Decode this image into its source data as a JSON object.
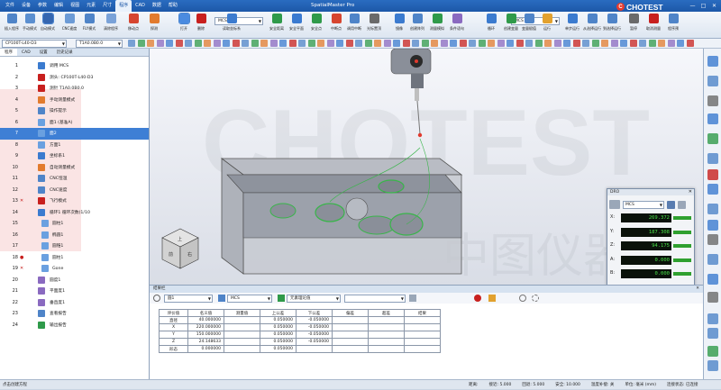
{
  "title_bar": {
    "menus": [
      "文件",
      "设备",
      "参数",
      "编辑",
      "视图",
      "元素",
      "尺寸",
      "程序",
      "CAD",
      "数据",
      "帮助"
    ],
    "active_menu": "程序",
    "app_title": "SpatialMaster Pro",
    "logo_text": "CHOTEST",
    "logo_mark": "C",
    "window_controls": [
      "—",
      "□",
      "✕"
    ]
  },
  "ribbon": {
    "buttons": [
      {
        "label": "插入程序",
        "icon": "insert-program-icon",
        "color": "#4f84c8"
      },
      {
        "label": "手动模式",
        "icon": "manual-mode-icon",
        "color": "#5b8fd0"
      },
      {
        "label": "自动模式",
        "icon": "cnc-auto-mode-icon",
        "color": "#3566b0",
        "selected": true
      },
      {
        "label": "CNC速度",
        "icon": "cnc-speed-icon",
        "color": "#6c9bd6"
      },
      {
        "label": "FLY模式",
        "icon": "fly-mode-icon",
        "color": "#4f84c8"
      },
      {
        "label": "清除程序",
        "icon": "clear-program-icon",
        "color": "#7aa2d8"
      },
      {
        "label": "移动点",
        "icon": "move-point-icon",
        "color": "#d6452f"
      },
      {
        "label": "探测",
        "icon": "probe-icon",
        "color": "#e27b2e"
      },
      {
        "label": "打开",
        "icon": "open-icon",
        "color": "#4a8be0",
        "selected": true
      },
      {
        "label": "删除",
        "icon": "delete-icon",
        "color": "#c8201e"
      },
      {
        "label": "读取坐标系",
        "icon": "read-csys-icon",
        "color": "#3b7bcf"
      },
      {
        "label": "安全距离",
        "icon": "safe-distance-icon",
        "color": "#2f9a4a"
      },
      {
        "label": "安全平面",
        "icon": "safe-plane-icon",
        "color": "#3a7ad0"
      },
      {
        "label": "安全点",
        "icon": "safe-point-icon",
        "color": "#2f9a4a"
      },
      {
        "label": "中断点",
        "icon": "stop-icon",
        "color": "#d6452f"
      },
      {
        "label": "调用中断",
        "icon": "call-interrupt-icon",
        "color": "#4f84c8"
      },
      {
        "label": "光标置顶",
        "icon": "cursor-top-icon",
        "color": "#6a6a6a"
      },
      {
        "label": "镜像",
        "icon": "mirror-icon",
        "color": "#3b7bcf"
      },
      {
        "label": "创建阵列",
        "icon": "array-icon",
        "color": "#4f84c8"
      },
      {
        "label": "测量模拟",
        "icon": "measure-sim-icon",
        "color": "#2f9a4a"
      },
      {
        "label": "条件语句",
        "icon": "condition-icon",
        "color": "#8a6ac0"
      },
      {
        "label": "循环",
        "icon": "loop-icon",
        "color": "#3b7bcf"
      },
      {
        "label": "创建变量",
        "icon": "create-variable-icon",
        "color": "#2f9a4a"
      },
      {
        "label": "变量赋值",
        "icon": "assign-variable-icon",
        "color": "#4f84c8"
      },
      {
        "label": "运行",
        "icon": "run-icon",
        "color": "#e2a12e"
      },
      {
        "label": "单步运行",
        "icon": "step-run-icon",
        "color": "#3b7bcf"
      },
      {
        "label": "从选择运行",
        "icon": "run-from-selection-icon",
        "color": "#4f84c8"
      },
      {
        "label": "到选择运行",
        "icon": "run-to-selection-icon",
        "color": "#4f84c8"
      },
      {
        "label": "暂停",
        "icon": "pause-icon",
        "color": "#6a6a6a"
      },
      {
        "label": "取消测量",
        "icon": "cancel-measure-icon",
        "color": "#c8201e"
      },
      {
        "label": "程序预",
        "icon": "program-preview-icon",
        "color": "#4f84c8"
      }
    ],
    "csys_select": "MCS",
    "csys_select_right": "MCS"
  },
  "toolbar2": {
    "probe_select": "CP100T-L40-D3",
    "tip_select": "T1A0.0B0.0"
  },
  "left_panel": {
    "tabs": [
      "程序",
      "CAD",
      "设置",
      "历史记录"
    ],
    "active_tab": "程序",
    "rows": [
      {
        "n": "1",
        "mark": "",
        "text": "调用 MCS",
        "color": "#3b7bcf",
        "indent": false
      },
      {
        "n": "2",
        "mark": "",
        "text": "测头: CP100T-L40-D3",
        "color": "#c8201e",
        "indent": false
      },
      {
        "n": "3",
        "mark": "",
        "text": "测针 T1A0.0B0.0",
        "color": "#c8201e",
        "indent": false
      },
      {
        "n": "4",
        "mark": "",
        "text": "手动测量模式",
        "color": "#e27b2e",
        "indent": false
      },
      {
        "n": "5",
        "mark": "",
        "text": "操作提示",
        "color": "#4f84c8",
        "indent": false
      },
      {
        "n": "6",
        "mark": "",
        "text": "面1 (基准A)",
        "color": "#6aa0e0",
        "indent": false
      },
      {
        "n": "7",
        "mark": "",
        "text": "面2",
        "color": "#6aa0e0",
        "indent": false,
        "highlight": true
      },
      {
        "n": "8",
        "mark": "",
        "text": "方面1",
        "color": "#6aa0e0",
        "indent": false
      },
      {
        "n": "9",
        "mark": "",
        "text": "坐标系1",
        "color": "#3b7bcf",
        "indent": false
      },
      {
        "n": "10",
        "mark": "",
        "text": "自动测量模式",
        "color": "#e27b2e",
        "indent": false
      },
      {
        "n": "11",
        "mark": "",
        "text": "CNC恒温",
        "color": "#4f84c8",
        "indent": false
      },
      {
        "n": "12",
        "mark": "",
        "text": "CNC速度",
        "color": "#4f84c8",
        "indent": false
      },
      {
        "n": "13",
        "mark": "✕",
        "text": "飞行模式",
        "color": "#c8201e",
        "indent": false
      },
      {
        "n": "14",
        "mark": "",
        "text": "循环1 循环次数(1/10",
        "color": "#3b7bcf",
        "indent": false
      },
      {
        "n": "15",
        "mark": "",
        "text": "圆柱1",
        "color": "#6aa0e0",
        "indent": true
      },
      {
        "n": "16",
        "mark": "",
        "text": "椭圆1",
        "color": "#6aa0e0",
        "indent": true
      },
      {
        "n": "17",
        "mark": "",
        "text": "圆锥1",
        "color": "#6aa0e0",
        "indent": true
      },
      {
        "n": "18",
        "mark": "●",
        "text": "圆柱1",
        "color": "#6aa0e0",
        "indent": true
      },
      {
        "n": "19",
        "mark": "✕",
        "text": "Gone",
        "color": "#6aa0e0",
        "indent": true
      },
      {
        "n": "20",
        "mark": "",
        "text": "圆度1",
        "color": "#8a6ac0",
        "indent": false
      },
      {
        "n": "21",
        "mark": "",
        "text": "平面度1",
        "color": "#8a6ac0",
        "indent": false
      },
      {
        "n": "22",
        "mark": "",
        "text": "垂直度1",
        "color": "#8a6ac0",
        "indent": false
      },
      {
        "n": "23",
        "mark": "",
        "text": "查看报告",
        "color": "#4f84c8",
        "indent": false
      },
      {
        "n": "24",
        "mark": "",
        "text": "输出报告",
        "color": "#2f9a4a",
        "indent": false
      }
    ]
  },
  "viewport": {
    "watermark_text": "CHOTEST",
    "watermark_cn": "中图仪器",
    "view_cube": {
      "top": "上",
      "front": "前",
      "right": "右"
    }
  },
  "dro": {
    "title": "DRO",
    "csys": "MCS",
    "rows": [
      {
        "axis": "X:",
        "value": "269.372"
      },
      {
        "axis": "Y:",
        "value": "187.308"
      },
      {
        "axis": "Z:",
        "value": "94.175"
      },
      {
        "axis": "A:",
        "value": "0.000"
      },
      {
        "axis": "B:",
        "value": "0.000"
      }
    ]
  },
  "result_panel": {
    "title": "结果栏",
    "feature_select": "圆1",
    "csys_select": "MCS",
    "element_select": "元素理论值",
    "table": {
      "headers": [
        "评价值",
        "名义值",
        "测量值",
        "上公差",
        "下公差",
        "偏差",
        "超差",
        "结果"
      ],
      "rows": [
        [
          "直径",
          "40.000000",
          "",
          "0.050000",
          "-0.050000",
          "",
          "",
          ""
        ],
        [
          "X",
          "220.000000",
          "",
          "0.050000",
          "-0.050000",
          "",
          "",
          ""
        ],
        [
          "Y",
          "150.000000",
          "",
          "0.050000",
          "-0.050000",
          "",
          "",
          ""
        ],
        [
          "Z",
          "24.148633",
          "",
          "0.050000",
          "-0.050000",
          "",
          "",
          ""
        ],
        [
          "形态",
          "0.000000",
          "",
          "0.050000",
          "",
          "",
          "",
          ""
        ]
      ]
    }
  },
  "status_bar": {
    "left": "点击创建方程",
    "items": [
      "距离:",
      "接近: 5.000",
      "回退: 5.000",
      "安全: 10.000",
      "温度补偿: 关",
      "单位: 毫米 (mm)",
      "连接状态: 已连接"
    ]
  }
}
